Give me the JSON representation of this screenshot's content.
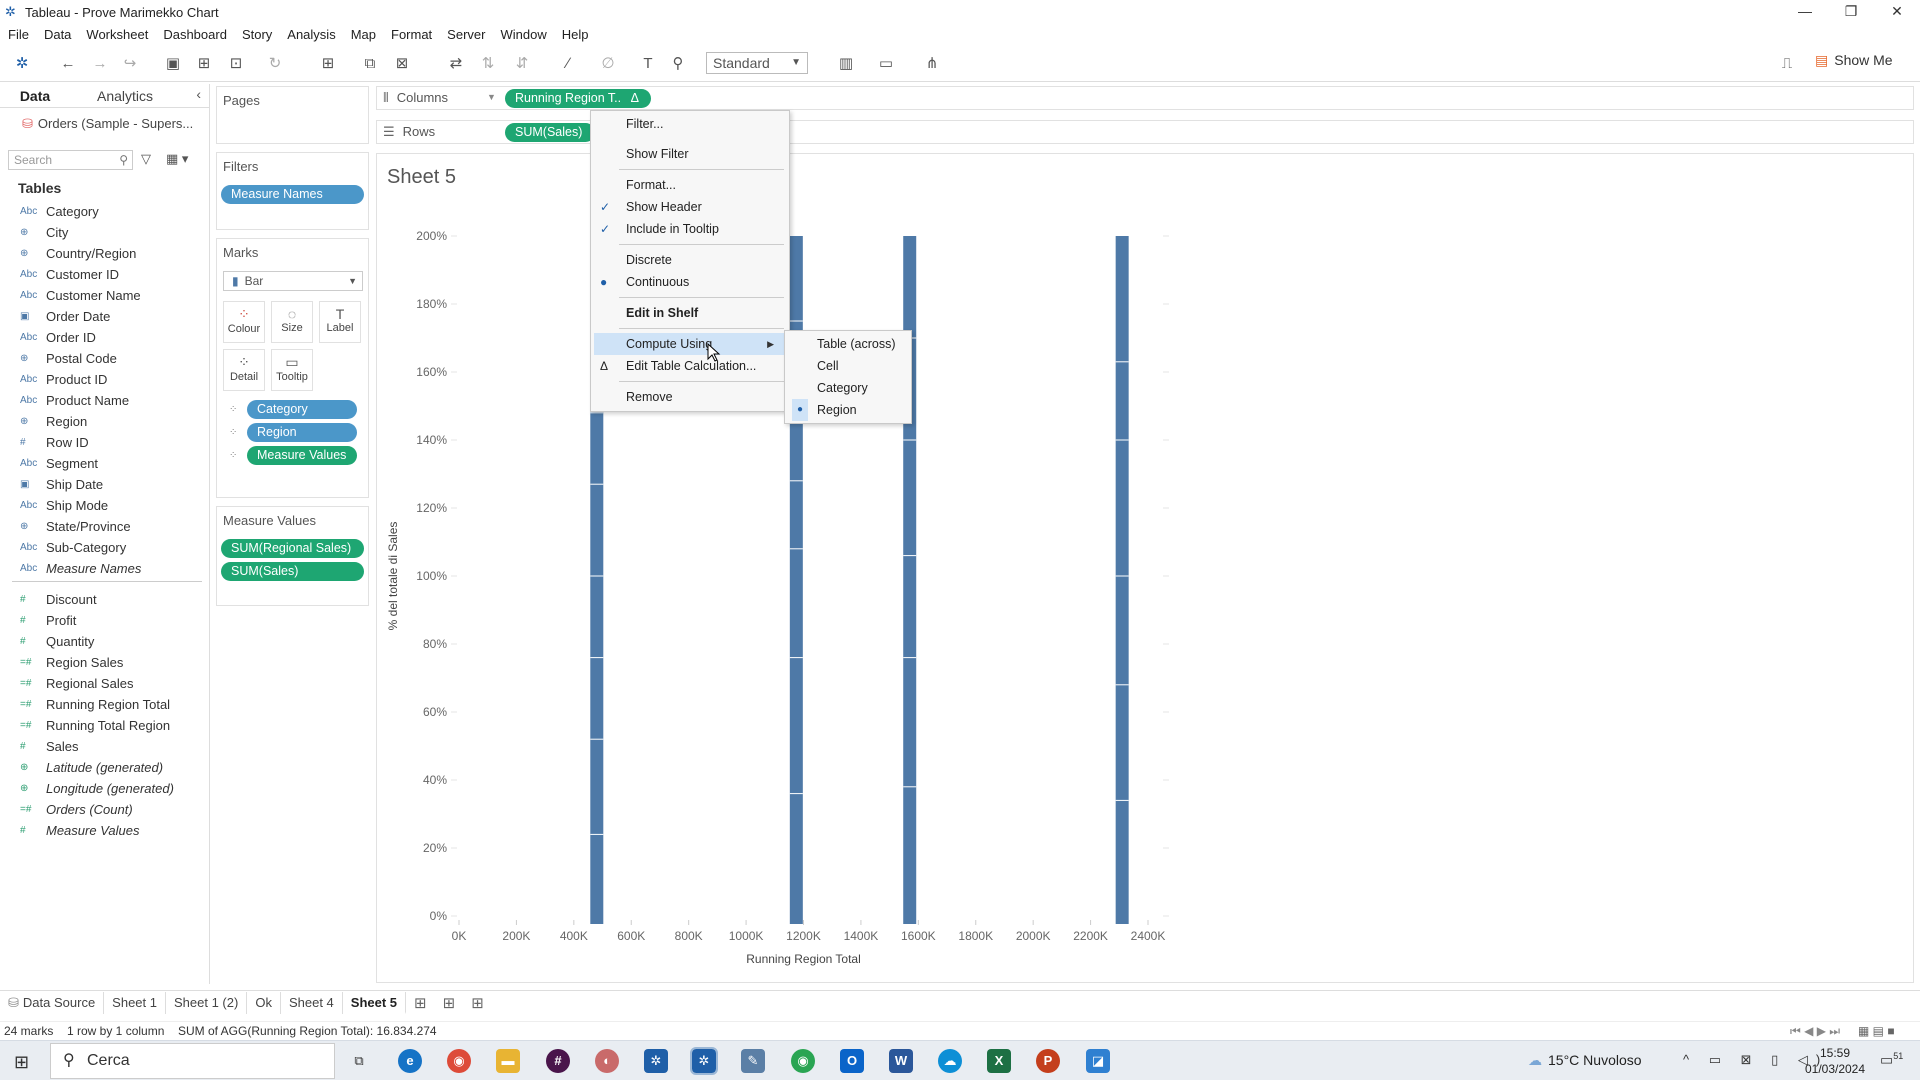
{
  "window": {
    "title": "Tableau - Prove Marimekko Chart"
  },
  "menu": [
    "File",
    "Data",
    "Worksheet",
    "Dashboard",
    "Story",
    "Analysis",
    "Map",
    "Format",
    "Server",
    "Window",
    "Help"
  ],
  "toolbar": {
    "fit_select": "Standard",
    "show_me": "Show Me"
  },
  "datapane": {
    "tab_data": "Data",
    "tab_analytics": "Analytics",
    "datasource": "Orders (Sample - Supers...",
    "search_placeholder": "Search",
    "tables_heading": "Tables",
    "dimensions": [
      {
        "type": "Abc",
        "name": "Category"
      },
      {
        "type": "globe",
        "name": "City"
      },
      {
        "type": "globe",
        "name": "Country/Region"
      },
      {
        "type": "Abc",
        "name": "Customer ID"
      },
      {
        "type": "Abc",
        "name": "Customer Name"
      },
      {
        "type": "date",
        "name": "Order Date"
      },
      {
        "type": "Abc",
        "name": "Order ID"
      },
      {
        "type": "globe",
        "name": "Postal Code"
      },
      {
        "type": "Abc",
        "name": "Product ID"
      },
      {
        "type": "Abc",
        "name": "Product Name"
      },
      {
        "type": "globe",
        "name": "Region"
      },
      {
        "type": "#",
        "name": "Row ID"
      },
      {
        "type": "Abc",
        "name": "Segment"
      },
      {
        "type": "date",
        "name": "Ship Date"
      },
      {
        "type": "Abc",
        "name": "Ship Mode"
      },
      {
        "type": "globe",
        "name": "State/Province"
      },
      {
        "type": "Abc",
        "name": "Sub-Category"
      },
      {
        "type": "Abc",
        "name": "Measure Names"
      }
    ],
    "measures": [
      {
        "type": "#",
        "name": "Discount"
      },
      {
        "type": "#",
        "name": "Profit"
      },
      {
        "type": "#",
        "name": "Quantity"
      },
      {
        "type": "=#",
        "name": "Region Sales"
      },
      {
        "type": "=#",
        "name": "Regional Sales"
      },
      {
        "type": "=#",
        "name": "Running Region Total"
      },
      {
        "type": "=#",
        "name": "Running Total Region"
      },
      {
        "type": "#",
        "name": "Sales"
      },
      {
        "type": "globe",
        "name": "Latitude (generated)"
      },
      {
        "type": "globe",
        "name": "Longitude (generated)"
      },
      {
        "type": "=#",
        "name": "Orders (Count)"
      },
      {
        "type": "#",
        "name": "Measure Values"
      }
    ]
  },
  "pages": {
    "title": "Pages"
  },
  "filters": {
    "title": "Filters",
    "pills": [
      "Measure Names"
    ]
  },
  "marks": {
    "title": "Marks",
    "type": "Bar",
    "buttons": [
      "Colour",
      "Size",
      "Label",
      "Detail",
      "Tooltip"
    ],
    "pills": [
      "Category",
      "Region",
      "Measure Values"
    ]
  },
  "measure_values": {
    "title": "Measure Values",
    "pills": [
      "SUM(Regional Sales)",
      "SUM(Sales)"
    ]
  },
  "shelves": {
    "columns_label": "Columns",
    "columns_pill": "Running Region T..",
    "columns_delta": "Δ",
    "rows_label": "Rows",
    "rows_pill": "SUM(Sales)"
  },
  "sheet": {
    "title": "Sheet 5"
  },
  "chart_data": {
    "type": "bar",
    "xlabel": "Running Region Total",
    "ylabel": "% del totale di Sales",
    "x_ticks": [
      "0K",
      "200K",
      "400K",
      "600K",
      "800K",
      "1000K",
      "1200K",
      "1400K",
      "1600K",
      "1800K",
      "2000K",
      "2200K",
      "2400K"
    ],
    "y_ticks": [
      "0%",
      "20%",
      "40%",
      "60%",
      "80%",
      "100%",
      "120%",
      "140%",
      "160%",
      "180%",
      "200%"
    ],
    "xlim": [
      0,
      2400000
    ],
    "ylim": [
      0,
      2.0
    ],
    "bars": [
      {
        "x": 480000,
        "top": 2.0,
        "segments": [
          0.24,
          0.52,
          0.76,
          1.0,
          1.27,
          1.48,
          1.72,
          2.0
        ]
      },
      {
        "x": 1175000,
        "top": 2.0,
        "segments": [
          0.36,
          0.76,
          1.08,
          1.28,
          1.58,
          1.75,
          2.0
        ]
      },
      {
        "x": 1570000,
        "top": 2.0,
        "segments": [
          0.38,
          0.76,
          1.06,
          1.4,
          1.7,
          2.0
        ]
      },
      {
        "x": 2310000,
        "top": 2.0,
        "segments": [
          0.34,
          0.68,
          1.0,
          1.4,
          1.63,
          2.0
        ]
      }
    ],
    "grid": false,
    "bar_color": "#4e79a7"
  },
  "context_menu": {
    "items": [
      {
        "label": "Filter...",
        "check": ""
      },
      {
        "label": "Show Filter",
        "check": ""
      },
      {
        "label": "Format...",
        "check": ""
      },
      {
        "label": "Show Header",
        "check": "✓"
      },
      {
        "label": "Include in Tooltip",
        "check": "✓"
      },
      {
        "label": "Discrete",
        "check": ""
      },
      {
        "label": "Continuous",
        "check": "●"
      },
      {
        "label": "Edit in Shelf",
        "check": ""
      },
      {
        "label": "Compute Using",
        "check": ""
      },
      {
        "label": "Edit Table Calculation...",
        "check": "Δ"
      },
      {
        "label": "Remove",
        "check": ""
      }
    ],
    "submenu": [
      {
        "label": "Table (across)",
        "check": ""
      },
      {
        "label": "Cell",
        "check": ""
      },
      {
        "label": "Category",
        "check": ""
      },
      {
        "label": "Region",
        "check": "●"
      }
    ]
  },
  "sheet_tabs": [
    "Data Source",
    "Sheet 1",
    "Sheet 1 (2)",
    "Ok",
    "Sheet 4",
    "Sheet 5"
  ],
  "status": {
    "marks": "24 marks",
    "rows_cols": "1 row by 1 column",
    "sum": "SUM of AGG(Running Region Total): 16.834.274"
  },
  "taskbar": {
    "search": "Cerca",
    "weather": "15°C  Nuvoloso",
    "time": "15:59",
    "date": "01/03/2024",
    "notifications": "51"
  }
}
